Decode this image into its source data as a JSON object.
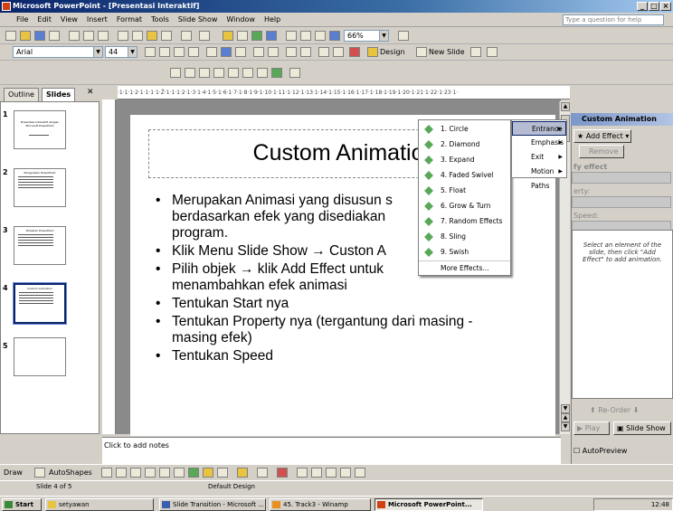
{
  "window": {
    "title": "Microsoft PowerPoint - [Presentasi Interaktif]"
  },
  "menu": [
    "File",
    "Edit",
    "View",
    "Insert",
    "Format",
    "Tools",
    "Slide Show",
    "Window",
    "Help"
  ],
  "help_placeholder": "Type a question for help",
  "toolbar": {
    "zoom": "66%",
    "font_name": "Arial",
    "font_size": "44",
    "design_label": "Design",
    "new_slide_label": "New Slide"
  },
  "pane_tabs": {
    "outline": "Outline",
    "slides": "Slides"
  },
  "thumbnails": [
    {
      "num": "1",
      "title": "Presentasi Interaktif dengan Microsoft PowerPoint"
    },
    {
      "num": "2",
      "title": "Pengenalan PowerPoint"
    },
    {
      "num": "3",
      "title": "Tampilan PowerPoint"
    },
    {
      "num": "4",
      "title": "Custom Animation"
    },
    {
      "num": "5",
      "title": ""
    }
  ],
  "ruler_top": "·1·1·1·2·1·1·1·1·Ž·1·1·1·2·1·3·1·4·1·5·1·6·1·7·1·8·1·9·1·10·1·11·1·12·1·13·1·14·1·15·1·16·1·17·1·18·1·19·1·20·1·21·1·22·1·23·1·",
  "slide": {
    "title": "Custom Animatio",
    "bullets": [
      "Merupakan Animasi yang disusun s\nberdasarkan efek yang disediakan\nprogram.",
      "Klik Menu Slide Show → Custon A",
      "Pilih objek → klik Add Effect untuk\nmenambahkan efek animasi",
      "Tentukan Start nya",
      "Tentukan Property nya (tergantung dari masing -\nmasing efek)",
      "Tentukan Speed"
    ]
  },
  "notes_placeholder": "Click to add notes",
  "effect_menu": {
    "categories": [
      "Entrance",
      "Emphasis",
      "Exit",
      "Motion Paths"
    ],
    "entrance_items": [
      "1. Circle",
      "2. Diamond",
      "3. Expand",
      "4. Faded Swivel",
      "5. Float",
      "6. Grow & Turn",
      "7. Random Effects",
      "8. Sling",
      "9. Swish",
      "More Effects..."
    ]
  },
  "task_pane": {
    "title": "Custom Animation",
    "add_effect": "Add Effect",
    "remove": "Remove",
    "modify_label": "fy effect",
    "property_label": "erty:",
    "speed_label": "Speed:",
    "hint": "Select an element of the slide, then click \"Add Effect\" to add animation.",
    "reorder": "Re-Order",
    "play": "Play",
    "slide_show": "Slide Show",
    "autopreview": "AutoPreview"
  },
  "drawbar": {
    "draw": "Draw",
    "autoshapes": "AutoShapes"
  },
  "status": {
    "slide": "Slide 4 of 5",
    "design": "Default Design"
  },
  "taskbar": {
    "start": "Start",
    "items": [
      "setyawan",
      "Slide Transition - Microsoft ...",
      "45. Track3 - Winamp",
      "Microsoft PowerPoint..."
    ],
    "clock": "12:48"
  }
}
